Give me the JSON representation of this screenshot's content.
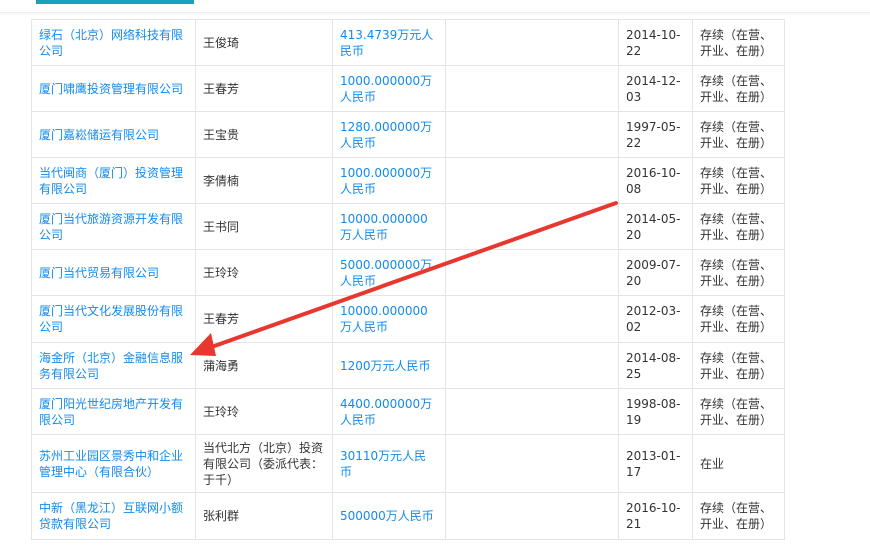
{
  "theme": {
    "link_color": "#128bed",
    "accent_color": "#17a2b8",
    "annotation_arrow_color": "#e8372f"
  },
  "table": {
    "rows": [
      {
        "company": "绿石（北京）网络科技有限公司",
        "person": "王俊琦",
        "capital": "413.4739万元人民币",
        "date": "2014-10-22",
        "status": "存续（在营、开业、在册）"
      },
      {
        "company": "厦门啸鹰投资管理有限公司",
        "person": "王春芳",
        "capital": "1000.000000万人民币",
        "date": "2014-12-03",
        "status": "存续（在营、开业、在册）"
      },
      {
        "company": "厦门嘉崧储运有限公司",
        "person": "王宝贵",
        "capital": "1280.000000万人民币",
        "date": "1997-05-22",
        "status": "存续（在营、开业、在册）"
      },
      {
        "company": "当代闽商（厦门）投资管理有限公司",
        "person": "李倩楠",
        "capital": "1000.000000万人民币",
        "date": "2016-10-08",
        "status": "存续（在营、开业、在册）"
      },
      {
        "company": "厦门当代旅游资源开发有限公司",
        "person": "王书同",
        "capital": "10000.000000万人民币",
        "date": "2014-05-20",
        "status": "存续（在营、开业、在册）"
      },
      {
        "company": "厦门当代贸易有限公司",
        "person": "王玲玲",
        "capital": "5000.000000万人民币",
        "date": "2009-07-20",
        "status": "存续（在营、开业、在册）"
      },
      {
        "company": "厦门当代文化发展股份有限公司",
        "person": "王春芳",
        "capital": "10000.000000万人民币",
        "date": "2012-03-02",
        "status": "存续（在营、开业、在册）"
      },
      {
        "company": "海金所（北京）金融信息服务有限公司",
        "person": "蒲海勇",
        "capital": "1200万元人民币",
        "date": "2014-08-25",
        "status": "存续（在营、开业、在册）"
      },
      {
        "company": "厦门阳光世纪房地产开发有限公司",
        "person": "王玲玲",
        "capital": "4400.000000万人民币",
        "date": "1998-08-19",
        "status": "存续（在营、开业、在册）"
      },
      {
        "company": "苏州工业园区景秀中和企业管理中心（有限合伙）",
        "person": "当代北方（北京）投资有限公司（委派代表：于千）",
        "capital": "30110万元人民币",
        "date": "2013-01-17",
        "status": "在业"
      },
      {
        "company": "中新（黑龙江）互联网小额贷款有限公司",
        "person": "张利群",
        "capital": "500000万人民币",
        "date": "2016-10-21",
        "status": "存续（在营、开业、在册）"
      }
    ]
  }
}
